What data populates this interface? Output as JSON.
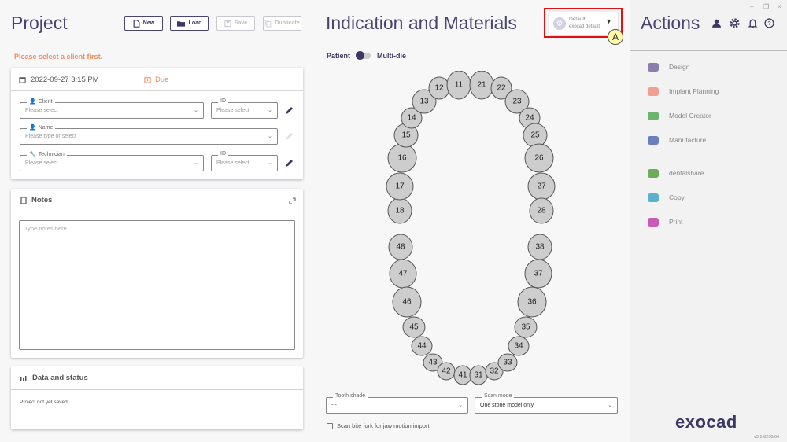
{
  "project": {
    "title": "Project",
    "toolbar": {
      "new_label": "New",
      "load_label": "Load",
      "save_label": "Save",
      "duplicate_label": "Duplicate"
    },
    "warning": "Please select a client first.",
    "date": "2022-09-27 3:15 PM",
    "due_label": "Due",
    "client": {
      "label": "Client",
      "placeholder": "Please select"
    },
    "client_id": {
      "label": "ID",
      "placeholder": "Please select"
    },
    "name": {
      "label": "Name",
      "placeholder": "Please type or select"
    },
    "technician": {
      "label": "Technician",
      "placeholder": "Please select"
    },
    "technician_id": {
      "label": "ID",
      "placeholder": "Please select"
    },
    "notes": {
      "title": "Notes",
      "placeholder": "Type notes here..."
    },
    "data_status": {
      "title": "Data and status",
      "text": "Project not yet saved"
    }
  },
  "indication": {
    "title": "Indication and Materials",
    "toggle": {
      "left_label": "Patient",
      "right_label": "Multi-die"
    },
    "profile": {
      "name": "Default",
      "sub": "exocad default"
    },
    "annotation_badge": "A",
    "upper_teeth": [
      "18",
      "17",
      "16",
      "15",
      "14",
      "13",
      "12",
      "11",
      "21",
      "22",
      "23",
      "24",
      "25",
      "26",
      "27",
      "28"
    ],
    "lower_teeth": [
      "48",
      "47",
      "46",
      "45",
      "44",
      "43",
      "42",
      "41",
      "31",
      "32",
      "33",
      "34",
      "35",
      "36",
      "37",
      "38"
    ],
    "tooth_shade": {
      "label": "Tooth shade",
      "value": "---"
    },
    "scan_mode": {
      "label": "Scan mode",
      "value": "One stone model only"
    },
    "bite_fork_label": "Scan bite fork for jaw motion import"
  },
  "actions": {
    "title": "Actions",
    "window": {
      "minimize": "–",
      "restore": "❐",
      "close": "×"
    },
    "group1": [
      {
        "label": "Design",
        "icon": "tooth-design-icon",
        "color": "#8a7fa8"
      },
      {
        "label": "Implant Planning",
        "icon": "implant-icon",
        "color": "#f0a090"
      },
      {
        "label": "Model Creator",
        "icon": "model-creator-icon",
        "color": "#6db56d"
      },
      {
        "label": "Manufacture",
        "icon": "gears-icon",
        "color": "#6a7fc0"
      }
    ],
    "group2": [
      {
        "label": "dentalshare",
        "icon": "dentalshare-icon",
        "color": "#6daa5a"
      },
      {
        "label": "Copy",
        "icon": "copy-folder-icon",
        "color": "#5bb0cc"
      },
      {
        "label": "Print",
        "icon": "printer-icon",
        "color": "#c95bb5"
      }
    ],
    "logo": "exocad",
    "version": "v3.1-8200/64"
  }
}
